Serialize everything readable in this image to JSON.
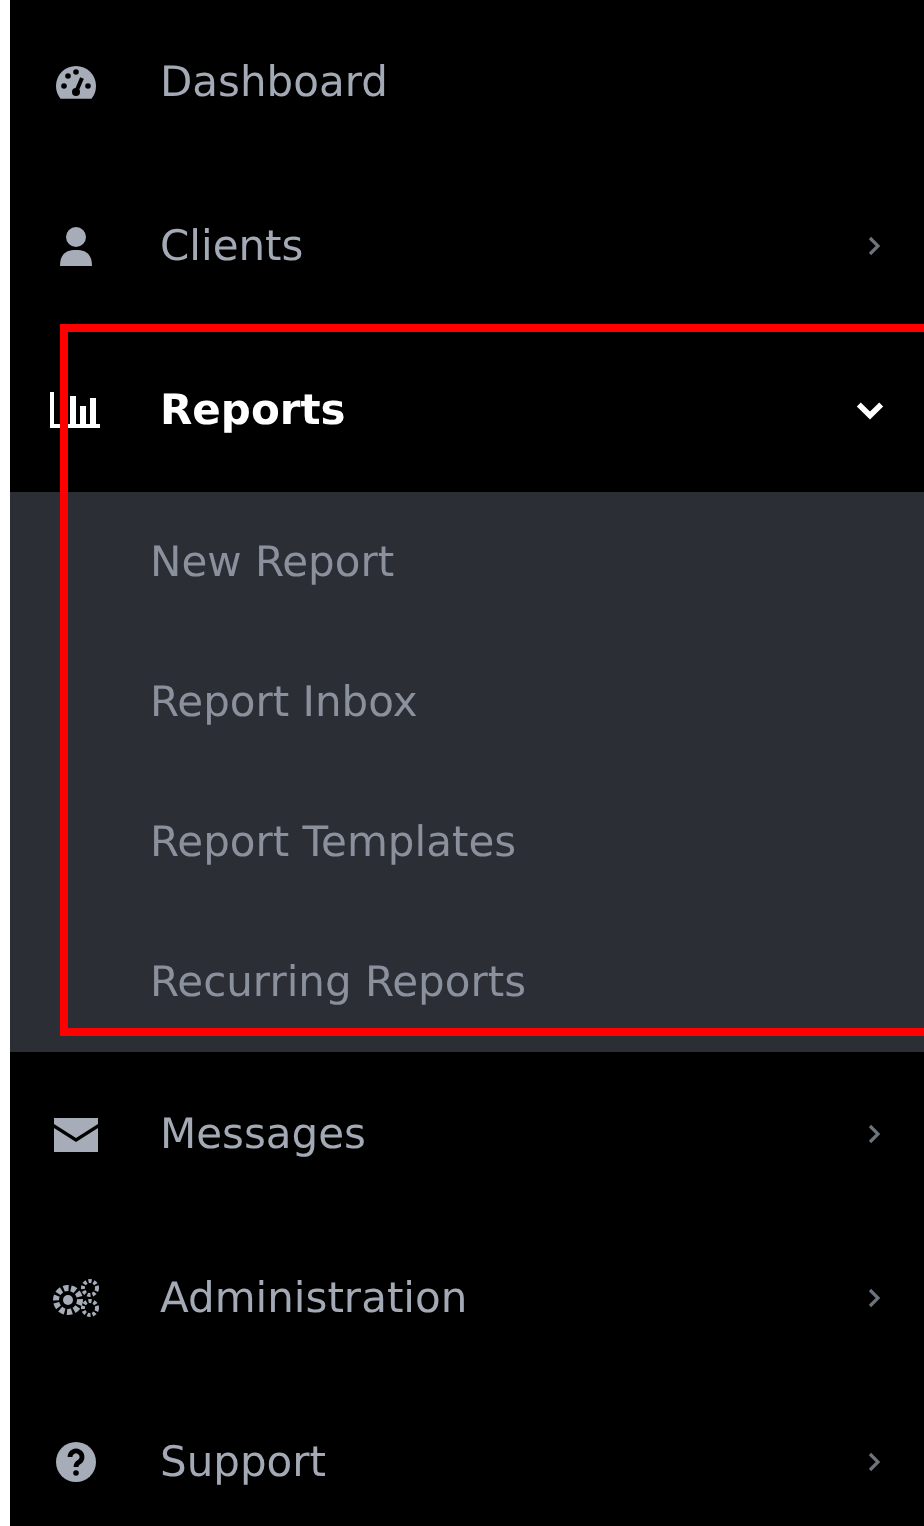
{
  "sidebar": {
    "items": [
      {
        "kind": "link",
        "label": "Dashboard",
        "selected": false,
        "highlighted": false
      },
      {
        "kind": "group",
        "label": "Clients",
        "expanded": false,
        "selected": false,
        "highlighted": false
      },
      {
        "kind": "group",
        "label": "Reports",
        "expanded": true,
        "selected": true,
        "highlighted": true,
        "children": [
          {
            "label": "New Report"
          },
          {
            "label": "Report Inbox"
          },
          {
            "label": "Report Templates"
          },
          {
            "label": "Recurring Reports"
          }
        ]
      },
      {
        "kind": "group",
        "label": "Messages",
        "expanded": false,
        "selected": false,
        "highlighted": false
      },
      {
        "kind": "group",
        "label": "Administration",
        "expanded": false,
        "selected": false,
        "highlighted": false
      },
      {
        "kind": "group",
        "label": "Support",
        "expanded": false,
        "selected": false,
        "highlighted": false
      }
    ]
  }
}
